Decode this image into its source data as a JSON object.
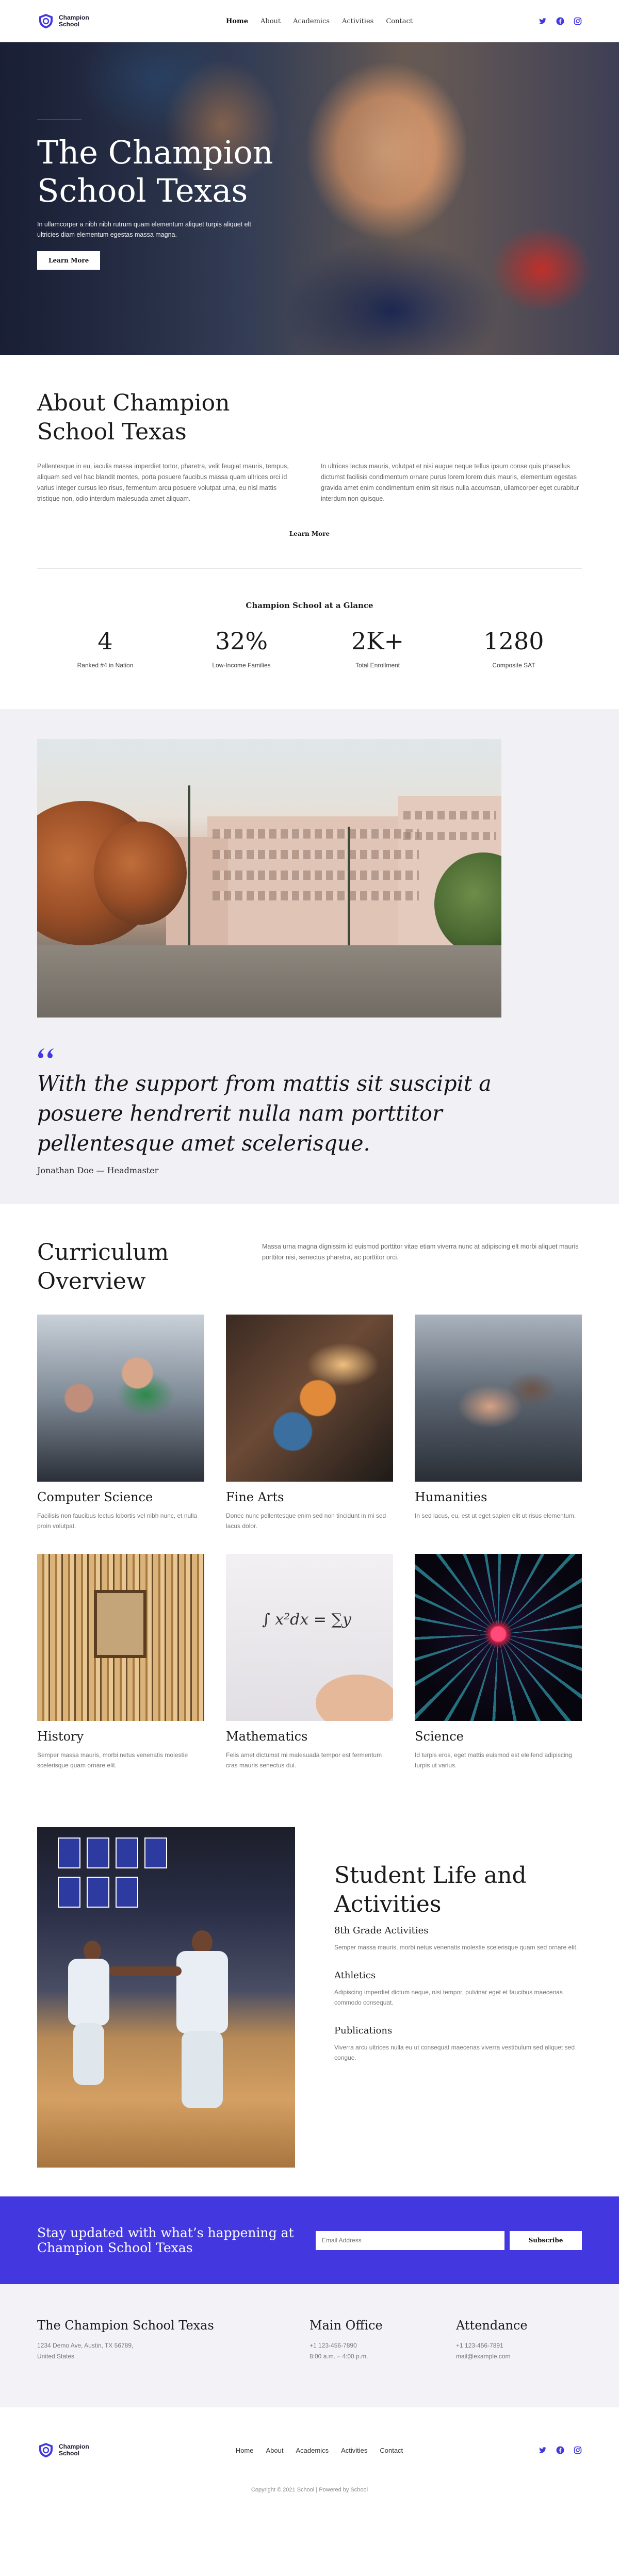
{
  "brand": {
    "name": "Champion School",
    "accent": "#4338e0"
  },
  "nav": [
    {
      "label": "Home",
      "active": true
    },
    {
      "label": "About"
    },
    {
      "label": "Academics"
    },
    {
      "label": "Activities"
    },
    {
      "label": "Contact"
    }
  ],
  "socials": [
    "twitter-icon",
    "facebook-icon",
    "instagram-icon"
  ],
  "hero": {
    "title": "The Champion School Texas",
    "text": "In ullamcorper a nibh nibh rutrum quam elementum aliquet turpis aliquet elt ultricies diam elementum egestas massa magna.",
    "button": "Learn More"
  },
  "about": {
    "title": "About Champion School Texas",
    "col1": "Pellentesque in eu, iaculis massa imperdiet tortor, pharetra, velit feugiat mauris, tempus, aliquam sed vel hac blandit montes, porta posuere faucibus massa quam ultrices orci id varius integer cursus leo risus, fermentum arcu posuere volutpat urna, eu nisl mattis tristique non, odio interdum malesuada amet aliquam.",
    "col2": "In ultrices lectus mauris, volutpat et nisi augue neque tellus ipsum conse quis phasellus dictumst facilisis condimentum ornare purus lorem lorem duis mauris, elementum egestas gravida amet enim condimentum enim sit risus nulla accumsan, ullamcorper eget curabitur interdum non quisque.",
    "more": "Learn More"
  },
  "glance": {
    "title": "Champion School at a Glance",
    "stats": [
      {
        "value": "4",
        "label": "Ranked #4 in Nation"
      },
      {
        "value": "32%",
        "label": "Low-Income Families"
      },
      {
        "value": "2K+",
        "label": "Total Enrollment"
      },
      {
        "value": "1280",
        "label": "Composite SAT"
      }
    ]
  },
  "quote": {
    "text": "With the support from mattis sit suscipit a posuere hendrerit nulla nam porttitor pellentesque amet scelerisque.",
    "author": "Jonathan Doe — Headmaster"
  },
  "curriculum": {
    "title": "Curriculum Overview",
    "intro": "Massa urna magna dignissim id euismod porttitor vitae etiam viverra nunc at adipiscing elt morbi aliquet mauris porttitor nisi, senectus pharetra, ac porttitor orci.",
    "items": [
      {
        "title": "Computer Science",
        "text": "Facilisis non faucibus lectus lobortis vel nibh nunc, et nulla proin volutpat."
      },
      {
        "title": "Fine Arts",
        "text": "Donec nunc pellentesque enim sed non tincidunt in mi sed lacus dolor."
      },
      {
        "title": "Humanities",
        "text": "In sed lacus, eu, est ut eget sapien elit ut risus elementum."
      },
      {
        "title": "History",
        "text": "Semper massa mauris, morbi netus venenatis molestie scelerisque quam ornare elit."
      },
      {
        "title": "Mathematics",
        "text": "Felis amet dictumst mi malesuada tempor est fermentum cras mauris senectus dui."
      },
      {
        "title": "Science",
        "text": "Id turpis eros, eget mattis euismod est eleifend adipiscing turpis ut varius."
      }
    ]
  },
  "student_life": {
    "title": "Student Life and Activities",
    "items": [
      {
        "title": "8th Grade Activities",
        "text": "Semper massa mauris, morbi netus venenatis molestie scelerisque quam sed ornare elit."
      },
      {
        "title": "Athletics",
        "text": "Adipiscing imperdiet dictum neque, nisi tempor, pulvinar eget et faucibus maecenas commodo consequat."
      },
      {
        "title": "Publications",
        "text": "Viverra arcu ultrices nulla eu ut consequat maecenas viverra vestibulum sed aliquet sed congue."
      }
    ]
  },
  "newsletter": {
    "title": "Stay updated with what’s happening at Champion School Texas",
    "placeholder": "Email Address",
    "button": "Subscribe"
  },
  "footer": {
    "school": {
      "title": "The Champion School Texas",
      "address1": "1234 Demo Ave, Austin, TX 56789,",
      "address2": "United States"
    },
    "office": {
      "title": "Main Office",
      "phone": "+1 123-456-7890",
      "hours": "8:00 a.m. – 4:00 p.m."
    },
    "attendance": {
      "title": "Attendance",
      "phone": "+1 123-456-7891",
      "email": "mail@example.com"
    },
    "copyright": "Copyright © 2021 School | Powered by School"
  }
}
